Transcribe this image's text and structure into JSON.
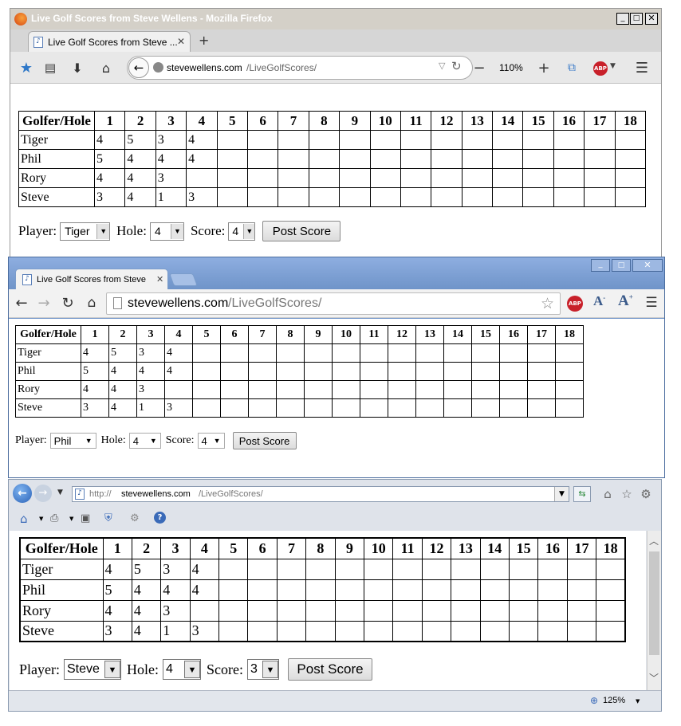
{
  "firefox": {
    "window_title": "Live Golf Scores from Steve Wellens - Mozilla Firefox",
    "tab_title": "Live Golf Scores from Steve ...",
    "url_host": "stevewellens.com",
    "url_path": "/LiveGolfScores/",
    "zoom": "110%",
    "player_value": "Tiger",
    "hole_value": "4",
    "score_value": "4"
  },
  "chrome": {
    "tab_title": "Live Golf Scores from Steve",
    "url_host": "stevewellens.com",
    "url_path": "/LiveGolfScores/",
    "player_value": "Phil",
    "hole_value": "4",
    "score_value": "4"
  },
  "ie": {
    "url": "http://stevewellens.com/LiveGolfScores/",
    "url_prefix": "http://",
    "url_host": "stevewellens.com",
    "url_path": "/LiveGolfScores/",
    "player_value": "Steve",
    "hole_value": "4",
    "score_value": "3",
    "zoom": "125%"
  },
  "form": {
    "player_label": "Player:",
    "hole_label": "Hole:",
    "score_label": "Score:",
    "post_label": "Post Score"
  },
  "scoreboard": {
    "header_label": "Golfer/Hole",
    "holes": [
      "1",
      "2",
      "3",
      "4",
      "5",
      "6",
      "7",
      "8",
      "9",
      "10",
      "11",
      "12",
      "13",
      "14",
      "15",
      "16",
      "17",
      "18"
    ],
    "rows": [
      {
        "name": "Tiger",
        "scores": [
          "4",
          "5",
          "3",
          "4",
          "",
          "",
          "",
          "",
          "",
          "",
          "",
          "",
          "",
          "",
          "",
          "",
          "",
          ""
        ]
      },
      {
        "name": "Phil",
        "scores": [
          "5",
          "4",
          "4",
          "4",
          "",
          "",
          "",
          "",
          "",
          "",
          "",
          "",
          "",
          "",
          "",
          "",
          "",
          ""
        ]
      },
      {
        "name": "Rory",
        "scores": [
          "4",
          "4",
          "3",
          "",
          "",
          "",
          "",
          "",
          "",
          "",
          "",
          "",
          "",
          "",
          "",
          "",
          "",
          ""
        ]
      },
      {
        "name": "Steve",
        "scores": [
          "3",
          "4",
          "1",
          "3",
          "",
          "",
          "",
          "",
          "",
          "",
          "",
          "",
          "",
          "",
          "",
          "",
          "",
          ""
        ]
      }
    ]
  },
  "icons": {
    "firefox_logo": "firefox-logo-icon",
    "bookmark": "star-icon",
    "back": "back-arrow-icon",
    "adblock": "abp-icon"
  },
  "colors": {
    "firefox_titlebar": "#d4d0c8",
    "chrome_frame": "#6f94c9",
    "ie_frame": "#dfe3ea",
    "table_border": "#000000"
  }
}
